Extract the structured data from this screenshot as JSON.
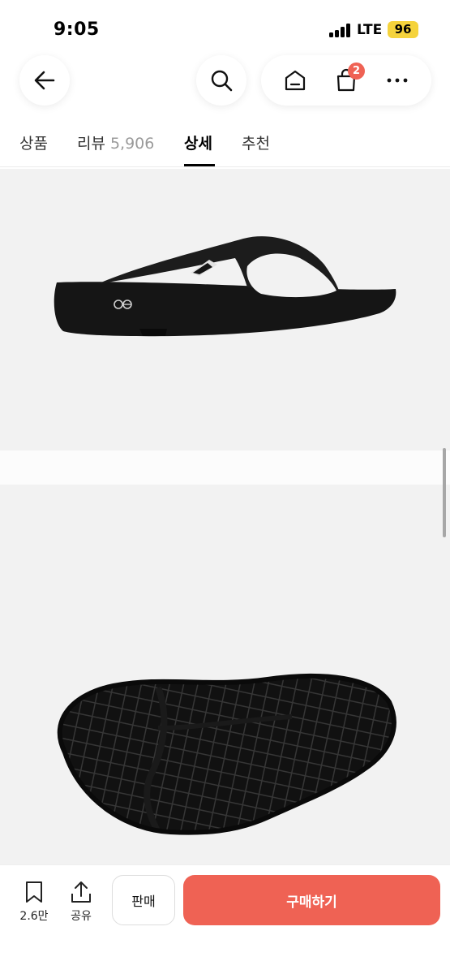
{
  "status_bar": {
    "time": "9:05",
    "network": "LTE",
    "battery": "96"
  },
  "top_nav": {
    "cart_badge": "2",
    "icons": [
      "back-arrow-icon",
      "search-icon",
      "home-icon",
      "shopping-bag-icon",
      "more-dots-icon"
    ]
  },
  "tabs": {
    "items": [
      {
        "label": "상품"
      },
      {
        "label": "리뷰",
        "count": "5,906"
      },
      {
        "label": "상세"
      },
      {
        "label": "추천"
      }
    ],
    "active": "상세"
  },
  "product_images": [
    "sandal-side-view",
    "sandal-sole-view"
  ],
  "bottom_bar": {
    "bookmark_count": "2.6만",
    "share_label": "공유",
    "sell_label": "판매",
    "buy_label": "구매하기"
  },
  "colors": {
    "accent": "#ef6254",
    "battery": "#f5d33c",
    "image_bg": "#f2f2f2"
  }
}
